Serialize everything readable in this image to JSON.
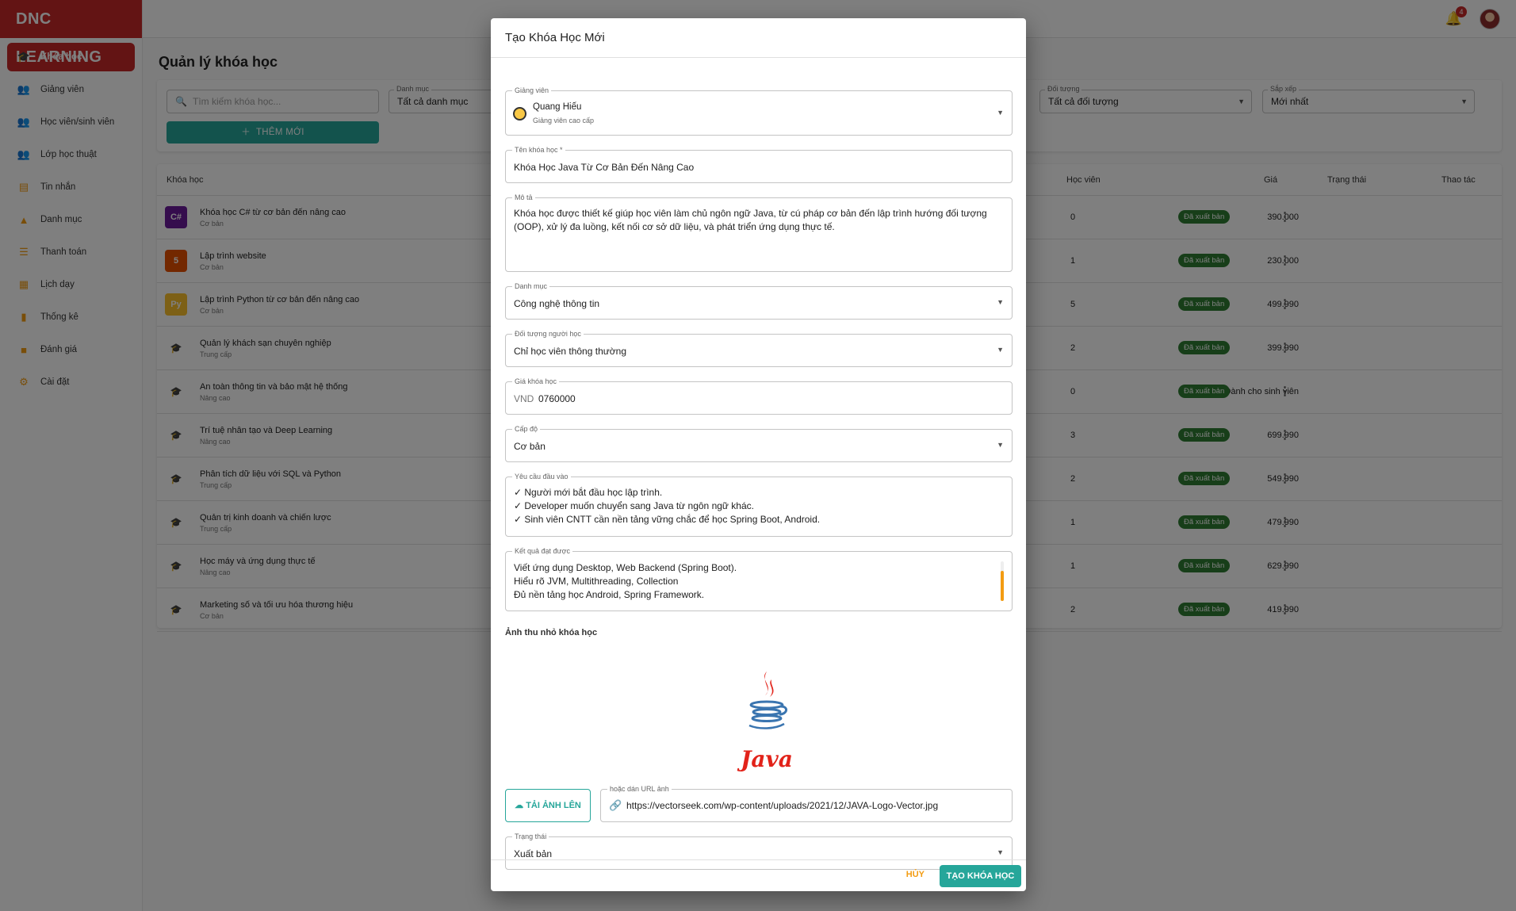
{
  "app": {
    "brand": "DNC LEARNING",
    "notification_count": "4"
  },
  "sidebar": {
    "items": [
      {
        "label": "Khóa học",
        "icon": "graduation-cap-icon"
      },
      {
        "label": "Giảng viên",
        "icon": "people-icon"
      },
      {
        "label": "Học viên/sinh viên",
        "icon": "people-icon"
      },
      {
        "label": "Lớp học thuật",
        "icon": "people-icon"
      },
      {
        "label": "Tin nhắn",
        "icon": "chat-icon"
      },
      {
        "label": "Danh mục",
        "icon": "category-icon"
      },
      {
        "label": "Thanh toán",
        "icon": "receipt-icon"
      },
      {
        "label": "Lịch dạy",
        "icon": "calendar-icon"
      },
      {
        "label": "Thống kê",
        "icon": "bar-chart-icon"
      },
      {
        "label": "Đánh giá",
        "icon": "review-icon"
      },
      {
        "label": "Cài đặt",
        "icon": "gear-icon"
      }
    ]
  },
  "page": {
    "title": "Quản lý khóa học",
    "search_placeholder": "Tìm kiếm khóa học...",
    "filters": {
      "category_label": "Danh mục",
      "category_value": "Tất cả danh mục",
      "audience_label": "Đối tượng",
      "audience_value": "Tất cả đối tượng",
      "sort_label": "Sắp xếp",
      "sort_value": "Mới nhất"
    },
    "add_button": "THÊM MỚI"
  },
  "table": {
    "headers": {
      "course": "Khóa học",
      "students": "Học viên",
      "price": "Giá",
      "status": "Trạng thái",
      "actions": "Thao tác"
    },
    "rows": [
      {
        "name": "Khóa học C# từ cơ bản đến nâng cao",
        "level": "Cơ bản",
        "students": "0",
        "price": "390.000",
        "status": "Đã xuất bản"
      },
      {
        "name": "Lập trình website",
        "level": "Cơ bản",
        "students": "1",
        "price": "230.000",
        "status": "Đã xuất bản"
      },
      {
        "name": "Lập trình Python từ cơ bản đến nâng cao",
        "level": "Cơ bản",
        "students": "5",
        "price": "499.990",
        "status": "Đã xuất bản"
      },
      {
        "name": "Quản lý khách sạn chuyên nghiệp",
        "level": "Trung cấp",
        "students": "2",
        "price": "399.990",
        "status": "Đã xuất bản"
      },
      {
        "name": "An toàn thông tin và bảo mật hệ thống",
        "level": "Nâng cao",
        "students": "0",
        "price": "Dành cho sinh viên",
        "status": "Đã xuất bản"
      },
      {
        "name": "Trí tuệ nhân tạo và Deep Learning",
        "level": "Nâng cao",
        "students": "3",
        "price": "699.990",
        "status": "Đã xuất bản"
      },
      {
        "name": "Phân tích dữ liệu với SQL và Python",
        "level": "Trung cấp",
        "students": "2",
        "price": "549.990",
        "status": "Đã xuất bản"
      },
      {
        "name": "Quản trị kinh doanh và chiến lược",
        "level": "Trung cấp",
        "students": "1",
        "price": "479.990",
        "status": "Đã xuất bản"
      },
      {
        "name": "Học máy và ứng dụng thực tế",
        "level": "Nâng cao",
        "students": "1",
        "price": "629.990",
        "status": "Đã xuất bản"
      },
      {
        "name": "Marketing số và tối ưu hóa thương hiệu",
        "level": "Cơ bản",
        "students": "2",
        "price": "419.990",
        "status": "Đã xuất bản"
      }
    ]
  },
  "modal": {
    "title": "Tạo Khóa Học Mới",
    "instructor": {
      "label": "Giảng viên",
      "name": "Quang Hiếu",
      "role": "Giảng viên cao cấp"
    },
    "course_name": {
      "label": "Tên khóa học *",
      "value": "Khóa Học Java Từ Cơ Bản Đến Nâng Cao"
    },
    "description": {
      "label": "Mô tả",
      "value": "Khóa học được thiết kế giúp học viên làm chủ ngôn ngữ Java, từ cú pháp cơ bản đến lập trình hướng đối tượng (OOP), xử lý đa luồng, kết nối cơ sở dữ liệu, và phát triển ứng dụng thực tế."
    },
    "category": {
      "label": "Danh mục",
      "value": "Công nghệ thông tin"
    },
    "audience": {
      "label": "Đối tượng người học",
      "value": "Chỉ học viên thông thường"
    },
    "price": {
      "label": "Giá khóa học",
      "currency": "VND",
      "value": "0760000"
    },
    "level": {
      "label": "Cấp độ",
      "value": "Cơ bản"
    },
    "requirements": {
      "label": "Yêu cầu đầu vào",
      "lines": [
        "✓ Người mới bắt đầu học lập trình.",
        "✓ Developer muốn chuyển sang Java từ ngôn ngữ khác.",
        "✓ Sinh viên CNTT cần nền tảng vững chắc để học Spring Boot, Android."
      ]
    },
    "outcomes": {
      "label": "Kết quả đạt được",
      "lines": [
        "Viết ứng dụng Desktop, Web Backend (Spring Boot).",
        "Hiểu rõ JVM, Multithreading, Collection",
        "Đủ nền tảng học Android, Spring Framework."
      ]
    },
    "thumbnail": {
      "label": "Ảnh thu nhỏ khóa học",
      "logo_text": "Java",
      "upload_button": "TẢI ẢNH LÊN",
      "url_label": "hoặc dán URL ảnh",
      "url_value": "https://vectorseek.com/wp-content/uploads/2021/12/JAVA-Logo-Vector.jpg"
    },
    "status": {
      "label": "Trạng thái",
      "value": "Xuất bản"
    },
    "cancel_button": "HỦY",
    "create_button": "TẠO KHÓA HỌC"
  },
  "colors": {
    "brand": "#c62828",
    "accent": "#26a69a",
    "warning": "#f39c12",
    "status_published": "#2e7d32"
  }
}
